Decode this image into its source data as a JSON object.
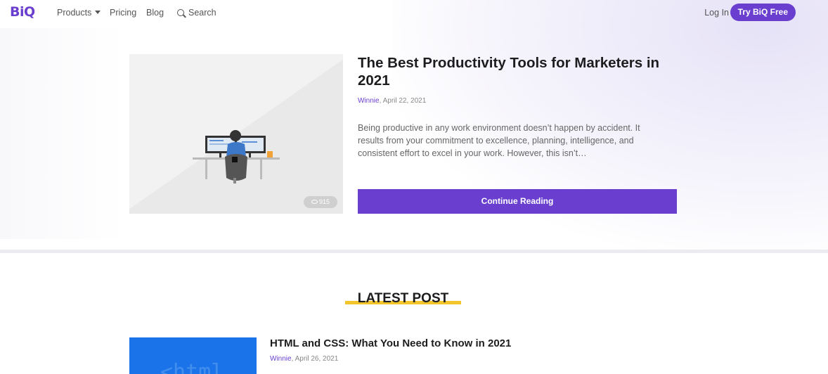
{
  "nav": {
    "logo": "BiQ",
    "products": "Products",
    "pricing": "Pricing",
    "blog": "Blog",
    "search": "Search",
    "login": "Log In",
    "try_free": "Try BiQ Free"
  },
  "featured": {
    "title": "The Best Productivity Tools for Marketers in 2021",
    "author": "Winnie",
    "date": ", April 22, 2021",
    "excerpt": "Being productive in any work environment doesn’t happen by accident. It results from your commitment to excellence, planning, intelligence, and consistent effort to excel in your work. However, this isn’t…",
    "views": "915",
    "cta": "Continue Reading"
  },
  "latest": {
    "heading": "LATEST POST",
    "posts": [
      {
        "title": "HTML and CSS: What You Need to Know in 2021",
        "author": "Winnie",
        "date": ", April 26, 2021"
      }
    ]
  },
  "colors": {
    "accent": "#6a3fcf",
    "highlight": "#f3c52c",
    "html_thumb": "#1a73e8"
  }
}
